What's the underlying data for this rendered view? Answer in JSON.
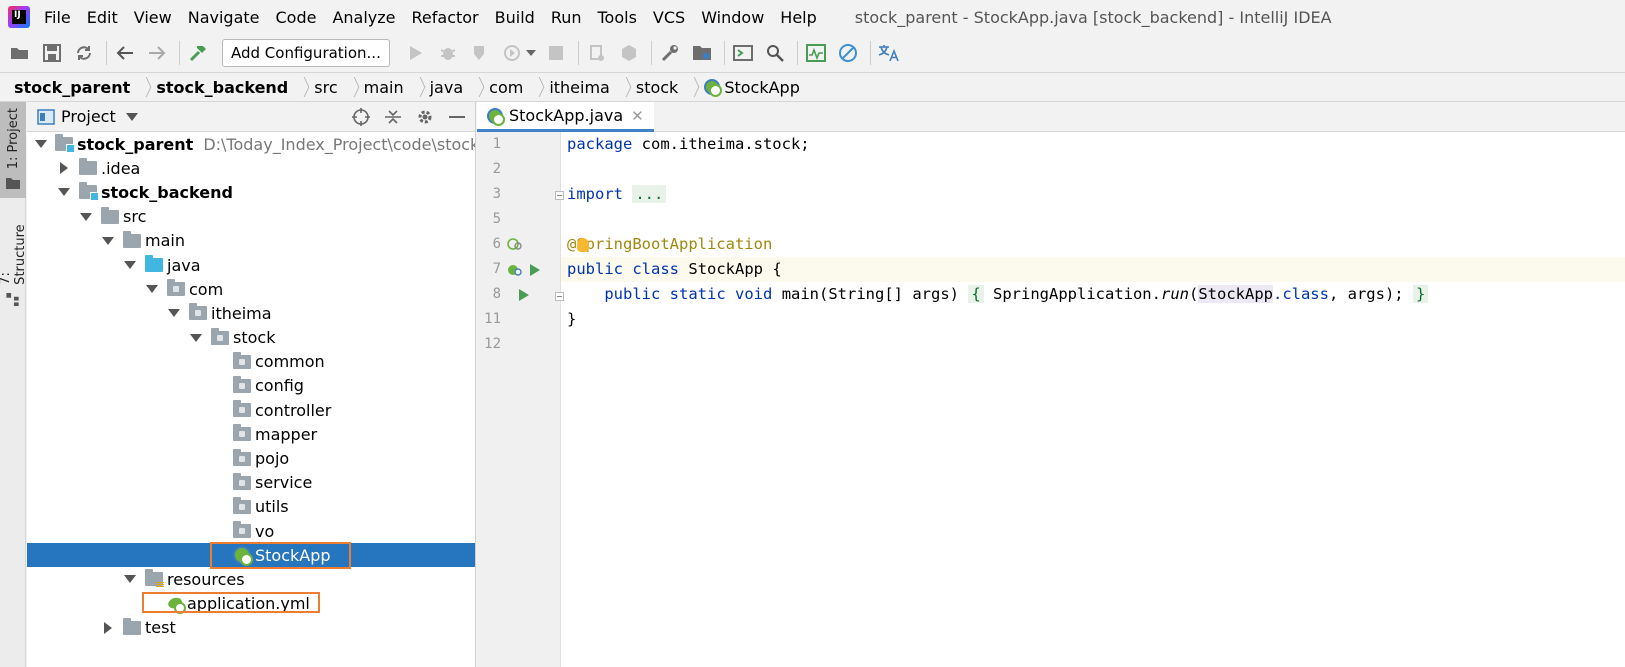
{
  "menubar": {
    "items": [
      "File",
      "Edit",
      "View",
      "Navigate",
      "Code",
      "Analyze",
      "Refactor",
      "Build",
      "Run",
      "Tools",
      "VCS",
      "Window",
      "Help"
    ],
    "window_title": "stock_parent - StockApp.java [stock_backend] - IntelliJ IDEA"
  },
  "toolbar": {
    "config_label": "Add Configuration..."
  },
  "breadcrumb": [
    "stock_parent",
    "stock_backend",
    "src",
    "main",
    "java",
    "com",
    "itheima",
    "stock",
    "StockApp"
  ],
  "left_strip": {
    "project_tab": "1: Project",
    "structure_tab": "7: Structure"
  },
  "project_panel": {
    "title": "Project",
    "tree": [
      {
        "label": "stock_parent",
        "path": "D:\\Today_Index_Project\\code\\stock_parent",
        "depth": 0,
        "arrow": "down",
        "icon": "module-folder",
        "bold": true
      },
      {
        "label": ".idea",
        "depth": 1,
        "arrow": "right",
        "icon": "folder"
      },
      {
        "label": "stock_backend",
        "depth": 1,
        "arrow": "down",
        "icon": "module-folder",
        "bold": true
      },
      {
        "label": "src",
        "depth": 2,
        "arrow": "down",
        "icon": "folder"
      },
      {
        "label": "main",
        "depth": 3,
        "arrow": "down",
        "icon": "folder"
      },
      {
        "label": "java",
        "depth": 4,
        "arrow": "down",
        "icon": "source-folder"
      },
      {
        "label": "com",
        "depth": 5,
        "arrow": "down",
        "icon": "package-folder"
      },
      {
        "label": "itheima",
        "depth": 6,
        "arrow": "down",
        "icon": "package-folder"
      },
      {
        "label": "stock",
        "depth": 7,
        "arrow": "down",
        "icon": "package-folder"
      },
      {
        "label": "common",
        "depth": 8,
        "arrow": "none",
        "icon": "package-folder"
      },
      {
        "label": "config",
        "depth": 8,
        "arrow": "none",
        "icon": "package-folder"
      },
      {
        "label": "controller",
        "depth": 8,
        "arrow": "none",
        "icon": "package-folder"
      },
      {
        "label": "mapper",
        "depth": 8,
        "arrow": "none",
        "icon": "package-folder"
      },
      {
        "label": "pojo",
        "depth": 8,
        "arrow": "none",
        "icon": "package-folder"
      },
      {
        "label": "service",
        "depth": 8,
        "arrow": "none",
        "icon": "package-folder"
      },
      {
        "label": "utils",
        "depth": 8,
        "arrow": "none",
        "icon": "package-folder"
      },
      {
        "label": "vo",
        "depth": 8,
        "arrow": "none",
        "icon": "package-folder"
      },
      {
        "label": "StockApp",
        "depth": 8,
        "arrow": "none",
        "icon": "spring-class",
        "selected": true,
        "highlighted": true
      },
      {
        "label": "resources",
        "depth": 4,
        "arrow": "down",
        "icon": "resources-folder"
      },
      {
        "label": "application.yml",
        "depth": 5,
        "arrow": "none",
        "icon": "spring-yml",
        "highlighted": true
      },
      {
        "label": "test",
        "depth": 3,
        "arrow": "right",
        "icon": "folder"
      }
    ]
  },
  "editor": {
    "tab_label": "StockApp.java",
    "line_numbers": [
      "1",
      "2",
      "3",
      "5",
      "6",
      "7",
      "8",
      "11",
      "12"
    ],
    "code": {
      "l1_kw": "package",
      "l1_rest": " com.itheima.stock;",
      "l3_kw": "import",
      "l3_fold": "...",
      "l6_ann": "@SpringBootApplication",
      "l7_kw1": "public",
      "l7_kw2": "class",
      "l7_cls": "StockApp",
      "l7_brace": " {",
      "l8_kw1": "public",
      "l8_kw2": "static",
      "l8_kw3": "void",
      "l8_method": "main",
      "l8_params": "(String[] args) ",
      "l8_fold_open": "{",
      "l8_call_obj": " SpringApplication.",
      "l8_call_method": "run",
      "l8_paren": "(",
      "l8_cls_ref": "StockApp",
      "l8_dot_class": ".class",
      "l8_tail": ", args); ",
      "l8_fold_close": "}",
      "l11": "}"
    }
  },
  "colors": {
    "selection": "#2675bf",
    "highlight_border": "#ed7d31",
    "keyword": "#0033b3",
    "annotation": "#9e880d"
  }
}
